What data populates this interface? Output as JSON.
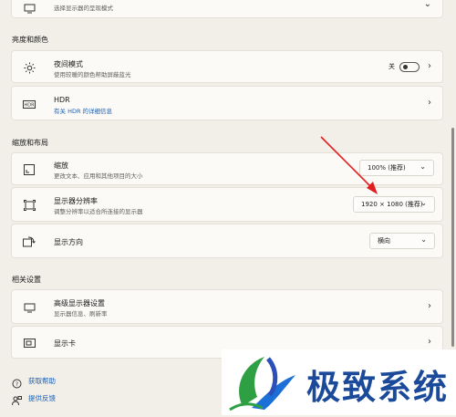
{
  "top_card": {
    "subtitle": "选择显示器的呈现模式"
  },
  "section_brightness": {
    "label": "亮度和颜色"
  },
  "night_mode": {
    "title": "夜间模式",
    "subtitle": "使用较暖的颜色帮助屏蔽蓝光",
    "toggle_state": "关"
  },
  "hdr": {
    "title": "HDR",
    "subtitle": "有关 HDR 的详细信息"
  },
  "section_scale": {
    "label": "缩放和布局"
  },
  "scale": {
    "title": "缩放",
    "subtitle": "更改文本、应用和其他项目的大小",
    "value": "100% (推荐)"
  },
  "resolution": {
    "title": "显示器分辨率",
    "subtitle": "调整分辨率以适合所连接的显示器",
    "value": "1920 × 1080 (推荐)"
  },
  "orientation": {
    "title": "显示方向",
    "value": "横向"
  },
  "section_related": {
    "label": "相关设置"
  },
  "advanced": {
    "title": "高级显示器设置",
    "subtitle": "显示器信息、刷新率"
  },
  "gpu": {
    "title": "显示卡"
  },
  "footer": {
    "help": "获取帮助",
    "feedback": "提供反馈"
  },
  "watermark": {
    "text": "极致系统"
  },
  "colors": {
    "accent": "#1a5fb4",
    "arrow": "#e02020",
    "background": "#f2efe9"
  },
  "icons": [
    "monitor-icon",
    "brightness-icon",
    "hdr-icon",
    "scale-icon",
    "resolution-icon",
    "orientation-icon",
    "monitor-icon",
    "display-card-icon",
    "help-icon",
    "feedback-icon"
  ]
}
